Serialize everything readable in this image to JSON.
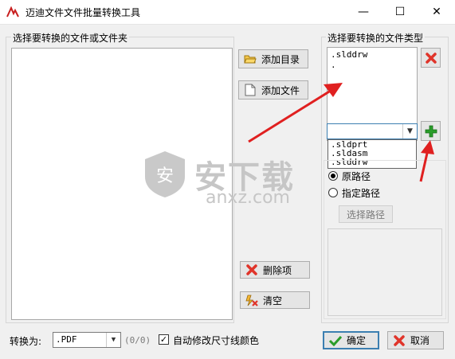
{
  "window": {
    "title": "迈迪文件文件批量转换工具",
    "controls": {
      "minimize": "—",
      "maximize": "☐",
      "close": "✕"
    }
  },
  "files_group": {
    "label": "选择要转换的文件或文件夹"
  },
  "file_buttons": {
    "add_directory": "添加目录",
    "add_file": "添加文件",
    "delete_item": "删除项",
    "clear": "清空"
  },
  "types_group": {
    "label": "选择要转换的文件类型",
    "list_items": [
      ".slddrw",
      "."
    ],
    "dropdown_value": "",
    "dropdown_options": [
      ".sldprt",
      ".sldasm",
      ".slddrw"
    ]
  },
  "path_options": {
    "original": "原路径",
    "specified": "指定路径",
    "browse": "选择路径",
    "selected": "original"
  },
  "bottom": {
    "convert_label": "转换为:",
    "format_value": ".PDF",
    "count": "(0/0)",
    "auto_modify_label": "自动修改尺寸线颜色",
    "auto_modify_checked": true,
    "ok": "确定",
    "cancel": "取消"
  },
  "watermark": {
    "text_cn": "安下载",
    "text_en": "anxz.com"
  },
  "colors": {
    "arrow": "#e02020",
    "plus": "#2a9d2a",
    "delete_x": "#e0342a",
    "ok_check": "#2a9d2a"
  }
}
